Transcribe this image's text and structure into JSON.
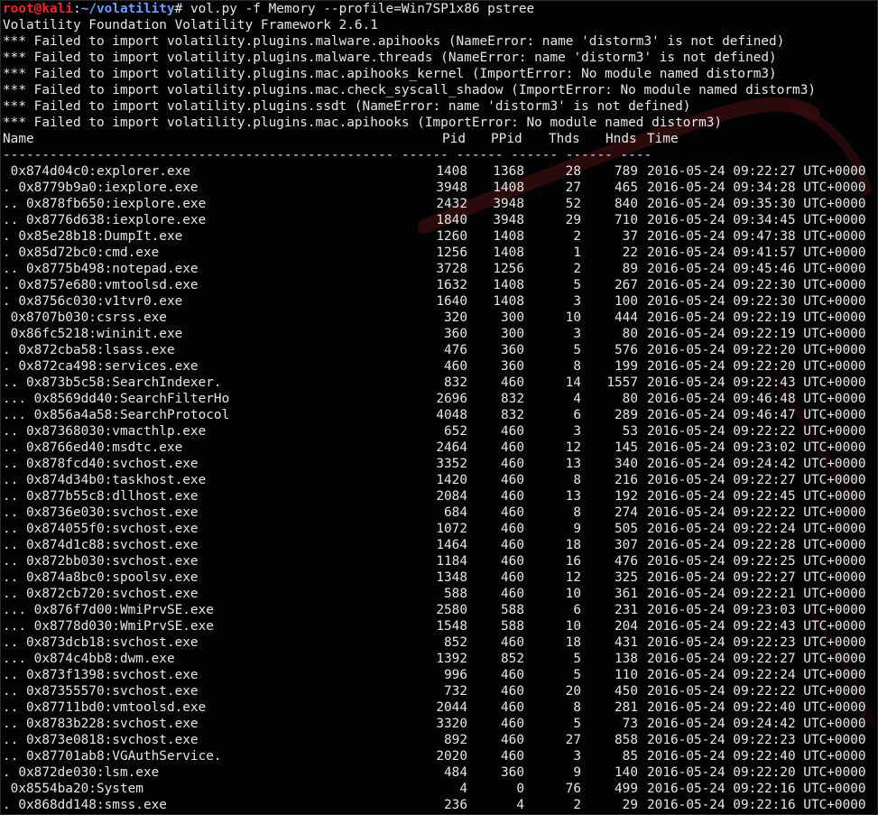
{
  "prompt": {
    "user": "root@kali",
    "path": "~/volatility",
    "command": "vol.py -f Memory --profile=Win7SP1x86 pstree"
  },
  "output_lines": [
    "Volatility Foundation Volatility Framework 2.6.1",
    "*** Failed to import volatility.plugins.malware.apihooks (NameError: name 'distorm3' is not defined)",
    "*** Failed to import volatility.plugins.malware.threads (NameError: name 'distorm3' is not defined)",
    "*** Failed to import volatility.plugins.mac.apihooks_kernel (ImportError: No module named distorm3)",
    "*** Failed to import volatility.plugins.mac.check_syscall_shadow (ImportError: No module named distorm3)",
    "*** Failed to import volatility.plugins.ssdt (NameError: name 'distorm3' is not defined)",
    "*** Failed to import volatility.plugins.mac.apihooks (ImportError: No module named distorm3)"
  ],
  "table": {
    "headers": {
      "name": "Name",
      "pid": "Pid",
      "ppid": "PPid",
      "thds": "Thds",
      "hnds": "Hnds",
      "time": "Time"
    },
    "separator": "-------------------------------------------------- ------ ------ ------ ------ ----",
    "rows": [
      {
        "name": " 0x874d04c0:explorer.exe",
        "pid": "1408",
        "ppid": "1368",
        "thds": "28",
        "hnds": "789",
        "time": "2016-05-24 09:22:27 UTC+0000"
      },
      {
        "name": ". 0x8779b9a0:iexplore.exe",
        "pid": "3948",
        "ppid": "1408",
        "thds": "27",
        "hnds": "465",
        "time": "2016-05-24 09:34:28 UTC+0000"
      },
      {
        "name": ".. 0x878fb650:iexplore.exe",
        "pid": "2432",
        "ppid": "3948",
        "thds": "52",
        "hnds": "840",
        "time": "2016-05-24 09:35:30 UTC+0000"
      },
      {
        "name": ".. 0x8776d638:iexplore.exe",
        "pid": "1840",
        "ppid": "3948",
        "thds": "29",
        "hnds": "710",
        "time": "2016-05-24 09:34:45 UTC+0000"
      },
      {
        "name": ". 0x85e28b18:DumpIt.exe",
        "pid": "1260",
        "ppid": "1408",
        "thds": "2",
        "hnds": "37",
        "time": "2016-05-24 09:47:38 UTC+0000"
      },
      {
        "name": ". 0x85d72bc0:cmd.exe",
        "pid": "1256",
        "ppid": "1408",
        "thds": "1",
        "hnds": "22",
        "time": "2016-05-24 09:41:57 UTC+0000"
      },
      {
        "name": ".. 0x8775b498:notepad.exe",
        "pid": "3728",
        "ppid": "1256",
        "thds": "2",
        "hnds": "89",
        "time": "2016-05-24 09:45:46 UTC+0000"
      },
      {
        "name": ". 0x8757e680:vmtoolsd.exe",
        "pid": "1632",
        "ppid": "1408",
        "thds": "5",
        "hnds": "267",
        "time": "2016-05-24 09:22:30 UTC+0000"
      },
      {
        "name": ". 0x8756c030:v1tvr0.exe",
        "pid": "1640",
        "ppid": "1408",
        "thds": "3",
        "hnds": "100",
        "time": "2016-05-24 09:22:30 UTC+0000"
      },
      {
        "name": " 0x8707b030:csrss.exe",
        "pid": "320",
        "ppid": "300",
        "thds": "10",
        "hnds": "444",
        "time": "2016-05-24 09:22:19 UTC+0000"
      },
      {
        "name": " 0x86fc5218:wininit.exe",
        "pid": "360",
        "ppid": "300",
        "thds": "3",
        "hnds": "80",
        "time": "2016-05-24 09:22:19 UTC+0000"
      },
      {
        "name": ". 0x872cba58:lsass.exe",
        "pid": "476",
        "ppid": "360",
        "thds": "5",
        "hnds": "576",
        "time": "2016-05-24 09:22:20 UTC+0000"
      },
      {
        "name": ". 0x872ca498:services.exe",
        "pid": "460",
        "ppid": "360",
        "thds": "8",
        "hnds": "199",
        "time": "2016-05-24 09:22:20 UTC+0000"
      },
      {
        "name": ".. 0x873b5c58:SearchIndexer.",
        "pid": "832",
        "ppid": "460",
        "thds": "14",
        "hnds": "1557",
        "time": "2016-05-24 09:22:43 UTC+0000"
      },
      {
        "name": "... 0x8569dd40:SearchFilterHo",
        "pid": "2696",
        "ppid": "832",
        "thds": "4",
        "hnds": "80",
        "time": "2016-05-24 09:46:48 UTC+0000"
      },
      {
        "name": "... 0x856a4a58:SearchProtocol",
        "pid": "4048",
        "ppid": "832",
        "thds": "6",
        "hnds": "289",
        "time": "2016-05-24 09:46:47 UTC+0000"
      },
      {
        "name": ".. 0x87368030:vmacthlp.exe",
        "pid": "652",
        "ppid": "460",
        "thds": "3",
        "hnds": "53",
        "time": "2016-05-24 09:22:22 UTC+0000"
      },
      {
        "name": ".. 0x8766ed40:msdtc.exe",
        "pid": "2464",
        "ppid": "460",
        "thds": "12",
        "hnds": "145",
        "time": "2016-05-24 09:23:02 UTC+0000"
      },
      {
        "name": ".. 0x878fcd40:svchost.exe",
        "pid": "3352",
        "ppid": "460",
        "thds": "13",
        "hnds": "340",
        "time": "2016-05-24 09:24:42 UTC+0000"
      },
      {
        "name": ".. 0x874d34b0:taskhost.exe",
        "pid": "1420",
        "ppid": "460",
        "thds": "8",
        "hnds": "216",
        "time": "2016-05-24 09:22:27 UTC+0000"
      },
      {
        "name": ".. 0x877b55c8:dllhost.exe",
        "pid": "2084",
        "ppid": "460",
        "thds": "13",
        "hnds": "192",
        "time": "2016-05-24 09:22:45 UTC+0000"
      },
      {
        "name": ".. 0x8736e030:svchost.exe",
        "pid": "684",
        "ppid": "460",
        "thds": "8",
        "hnds": "274",
        "time": "2016-05-24 09:22:22 UTC+0000"
      },
      {
        "name": ".. 0x874055f0:svchost.exe",
        "pid": "1072",
        "ppid": "460",
        "thds": "9",
        "hnds": "505",
        "time": "2016-05-24 09:22:24 UTC+0000"
      },
      {
        "name": ".. 0x874d1c88:svchost.exe",
        "pid": "1464",
        "ppid": "460",
        "thds": "18",
        "hnds": "307",
        "time": "2016-05-24 09:22:28 UTC+0000"
      },
      {
        "name": ".. 0x872bb030:svchost.exe",
        "pid": "1184",
        "ppid": "460",
        "thds": "16",
        "hnds": "476",
        "time": "2016-05-24 09:22:25 UTC+0000"
      },
      {
        "name": ".. 0x874a8bc0:spoolsv.exe",
        "pid": "1348",
        "ppid": "460",
        "thds": "12",
        "hnds": "325",
        "time": "2016-05-24 09:22:27 UTC+0000"
      },
      {
        "name": ".. 0x872cb720:svchost.exe",
        "pid": "588",
        "ppid": "460",
        "thds": "10",
        "hnds": "361",
        "time": "2016-05-24 09:22:21 UTC+0000"
      },
      {
        "name": "... 0x876f7d00:WmiPrvSE.exe",
        "pid": "2580",
        "ppid": "588",
        "thds": "6",
        "hnds": "231",
        "time": "2016-05-24 09:23:03 UTC+0000"
      },
      {
        "name": "... 0x8778d030:WmiPrvSE.exe",
        "pid": "1548",
        "ppid": "588",
        "thds": "10",
        "hnds": "204",
        "time": "2016-05-24 09:22:43 UTC+0000"
      },
      {
        "name": ".. 0x873dcb18:svchost.exe",
        "pid": "852",
        "ppid": "460",
        "thds": "18",
        "hnds": "431",
        "time": "2016-05-24 09:22:23 UTC+0000"
      },
      {
        "name": "... 0x874c4bb8:dwm.exe",
        "pid": "1392",
        "ppid": "852",
        "thds": "5",
        "hnds": "138",
        "time": "2016-05-24 09:22:27 UTC+0000"
      },
      {
        "name": ".. 0x873f1398:svchost.exe",
        "pid": "996",
        "ppid": "460",
        "thds": "5",
        "hnds": "110",
        "time": "2016-05-24 09:22:24 UTC+0000"
      },
      {
        "name": ".. 0x87355570:svchost.exe",
        "pid": "732",
        "ppid": "460",
        "thds": "20",
        "hnds": "450",
        "time": "2016-05-24 09:22:22 UTC+0000"
      },
      {
        "name": ".. 0x87711bd0:vmtoolsd.exe",
        "pid": "2044",
        "ppid": "460",
        "thds": "8",
        "hnds": "281",
        "time": "2016-05-24 09:22:40 UTC+0000"
      },
      {
        "name": ".. 0x8783b228:svchost.exe",
        "pid": "3320",
        "ppid": "460",
        "thds": "5",
        "hnds": "73",
        "time": "2016-05-24 09:24:42 UTC+0000"
      },
      {
        "name": ".. 0x873e0818:svchost.exe",
        "pid": "892",
        "ppid": "460",
        "thds": "27",
        "hnds": "858",
        "time": "2016-05-24 09:22:23 UTC+0000"
      },
      {
        "name": ".. 0x87701ab8:VGAuthService.",
        "pid": "2020",
        "ppid": "460",
        "thds": "3",
        "hnds": "85",
        "time": "2016-05-24 09:22:40 UTC+0000"
      },
      {
        "name": ". 0x872de030:lsm.exe",
        "pid": "484",
        "ppid": "360",
        "thds": "9",
        "hnds": "140",
        "time": "2016-05-24 09:22:20 UTC+0000"
      },
      {
        "name": " 0x8554ba20:System",
        "pid": "4",
        "ppid": "0",
        "thds": "76",
        "hnds": "499",
        "time": "2016-05-24 09:22:16 UTC+0000"
      },
      {
        "name": ". 0x868dd148:smss.exe",
        "pid": "236",
        "ppid": "4",
        "thds": "2",
        "hnds": "29",
        "time": "2016-05-24 09:22:16 UTC+0000"
      }
    ]
  },
  "colors": {
    "background": "#030306",
    "text": "#e6e6e6",
    "prompt_user": "#ef2929",
    "prompt_path": "#6d9bff",
    "wallpaper_mark": "#3a0d0d"
  }
}
